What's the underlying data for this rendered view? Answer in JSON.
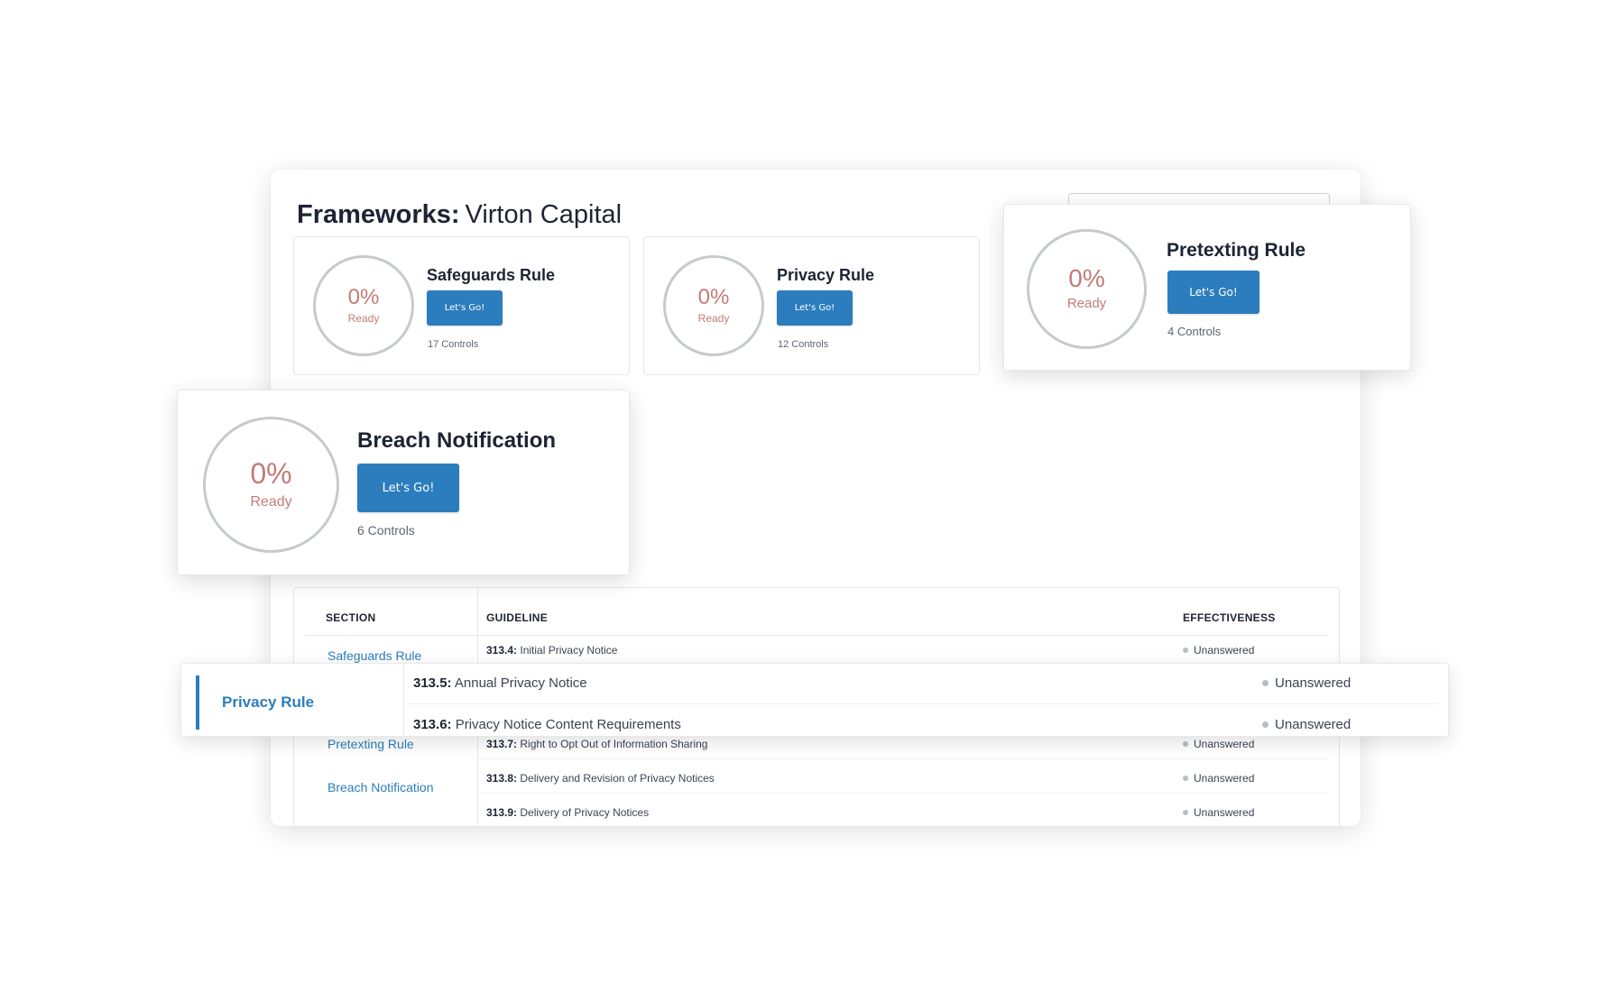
{
  "header": {
    "title_bold": "Frameworks:",
    "organization": "Virton Capital"
  },
  "cards": [
    {
      "name": "Safeguards Rule",
      "percent": "0%",
      "status": "Ready",
      "button": "Let's Go!",
      "controls": "17 Controls"
    },
    {
      "name": "Privacy Rule",
      "percent": "0%",
      "status": "Ready",
      "button": "Let's Go!",
      "controls": "12 Controls"
    },
    {
      "name": "Pretexting Rule",
      "percent": "0%",
      "status": "Ready",
      "button": "Let's Go!",
      "controls": "4 Controls"
    },
    {
      "name": "Breach Notification",
      "percent": "0%",
      "status": "Ready",
      "button": "Let's Go!",
      "controls": "6 Controls"
    }
  ],
  "table": {
    "headers": {
      "section": "SECTION",
      "guideline": "GUIDELINE",
      "effectiveness": "EFFECTIVENESS"
    },
    "sections": [
      "Safeguards Rule",
      "Privacy Rule",
      "Pretexting Rule",
      "Breach Notification"
    ],
    "rows": [
      {
        "code": "313.4:",
        "text": "Initial Privacy Notice",
        "status": "Unanswered"
      },
      {
        "code": "313.5:",
        "text": "Annual Privacy Notice",
        "status": "Unanswered"
      },
      {
        "code": "313.6:",
        "text": "Privacy Notice Content Requirements",
        "status": "Unanswered"
      },
      {
        "code": "313.7:",
        "text": "Right to Opt Out of Information Sharing",
        "status": "Unanswered"
      },
      {
        "code": "313.8:",
        "text": "Delivery and Revision of Privacy Notices",
        "status": "Unanswered"
      },
      {
        "code": "313.9:",
        "text": "Delivery of Privacy Notices",
        "status": "Unanswered"
      }
    ]
  },
  "colors": {
    "accent": "#2b7dbd",
    "ready_text": "#c47b79",
    "ring": "#c6cacc",
    "status_dot": "#b9bdc2"
  },
  "icons": {
    "status": "status-dot-icon"
  }
}
